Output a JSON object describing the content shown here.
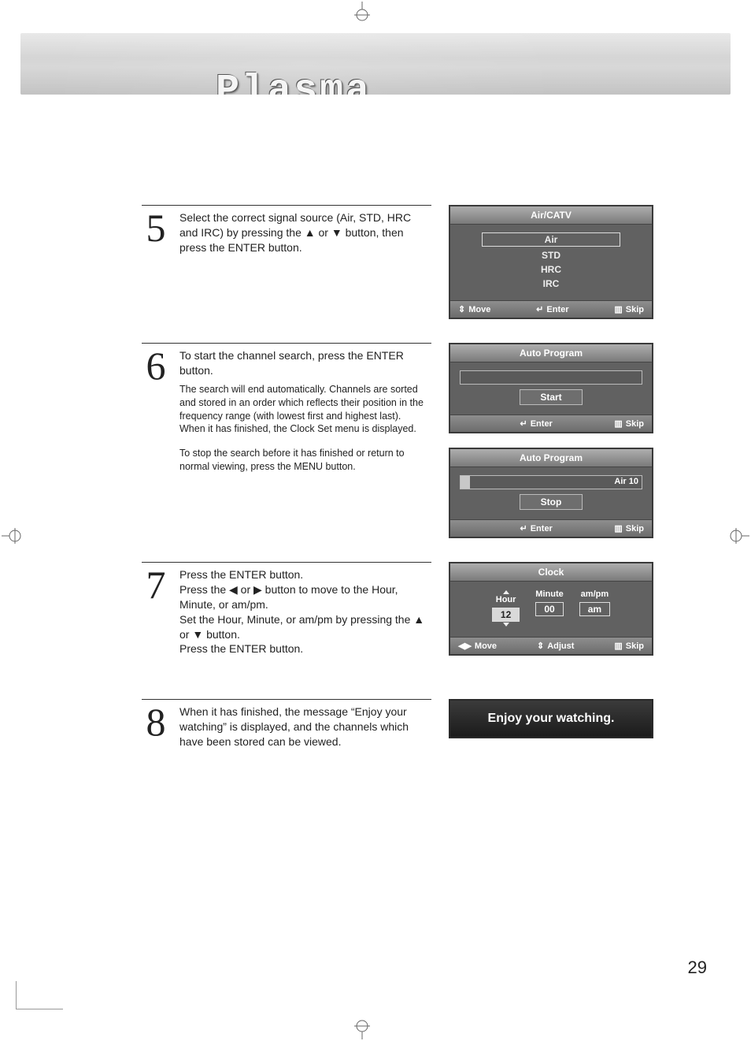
{
  "banner": {
    "title": "Plasma Display"
  },
  "page_number": "29",
  "steps": {
    "s5": {
      "num": "5",
      "text": "Select the correct signal source (Air, STD, HRC and IRC) by pressing the ▲ or ▼ button, then press the ENTER button."
    },
    "s6": {
      "num": "6",
      "text": "To start the channel search, press the ENTER button.",
      "sub1": "The search will end automatically. Channels are sorted and stored in an order which reflects their position in the frequency range (with lowest first and highest last).\nWhen it has finished, the Clock Set menu is displayed.",
      "sub2": "To stop the search before it has finished or return to normal viewing, press the MENU button."
    },
    "s7": {
      "num": "7",
      "l1": "Press the ENTER button.",
      "l2": "Press the ◀ or ▶ button to move to the Hour, Minute, or am/pm.",
      "l3": "Set the Hour, Minute, or am/pm by pressing the ▲ or ▼ button.",
      "l4": "Press the ENTER button."
    },
    "s8": {
      "num": "8",
      "text": "When it has finished, the message “Enjoy your watching” is displayed, and the channels which have been stored can be viewed."
    }
  },
  "osd_aircatv": {
    "title": "Air/CATV",
    "options": [
      "Air",
      "STD",
      "HRC",
      "IRC"
    ],
    "footer": {
      "move": "Move",
      "enter": "Enter",
      "skip": "Skip"
    }
  },
  "osd_auto1": {
    "title": "Auto Program",
    "button": "Start",
    "footer": {
      "enter": "Enter",
      "skip": "Skip"
    }
  },
  "osd_auto2": {
    "title": "Auto Program",
    "progress_label": "Air   10",
    "button": "Stop",
    "footer": {
      "enter": "Enter",
      "skip": "Skip"
    }
  },
  "osd_clock": {
    "title": "Clock",
    "cols": [
      {
        "hdr": "Hour",
        "val": "12",
        "sel": true
      },
      {
        "hdr": "Minute",
        "val": "00",
        "sel": false
      },
      {
        "hdr": "am/pm",
        "val": "am",
        "sel": false
      }
    ],
    "footer": {
      "move": "Move",
      "adjust": "Adjust",
      "skip": "Skip"
    }
  },
  "enjoy": "Enjoy your watching."
}
